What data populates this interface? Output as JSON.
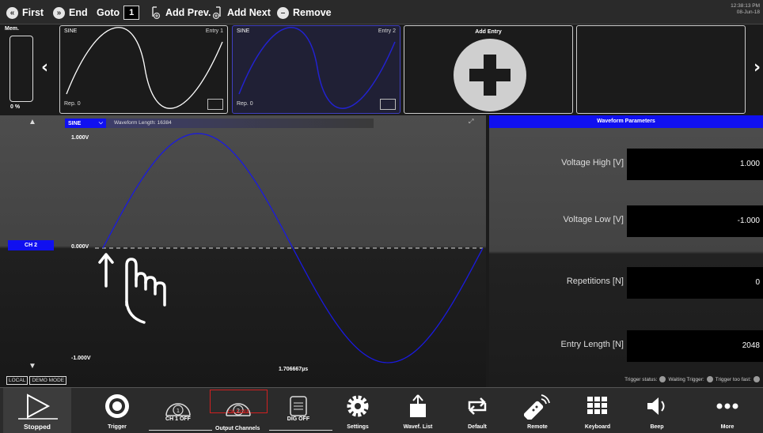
{
  "toolbar": {
    "first_label": "First",
    "end_label": "End",
    "goto_label": "Goto",
    "goto_value": "1",
    "add_prev_label": "Add Prev.",
    "add_next_label": "Add Next",
    "remove_label": "Remove",
    "time": "12:38:13 PM",
    "date": "08-Jun-18"
  },
  "sequence": {
    "mem_label": "Mem.",
    "mem_percent": "0 %",
    "entries": [
      {
        "name": "SINE",
        "entry": "Entry 1",
        "rep": "Rep. 0",
        "selected": false
      },
      {
        "name": "SINE",
        "entry": "Entry 2",
        "rep": "Rep. 0",
        "selected": true
      }
    ],
    "add_entry_label": "Add Entry"
  },
  "plot": {
    "waveform_select": "SINE",
    "waveform_length": "Waveform Length: 16384",
    "y_max": "1.000V",
    "y_mid": "0.000V",
    "y_min": "-1.000V",
    "x_label": "1.706667µs",
    "channel": "CH 2",
    "local_tag": "LOCAL",
    "demo_tag": "DEMO MODE",
    "trace_color": "#1a1ae0"
  },
  "params": {
    "header": "Waveform Parameters",
    "rows": [
      {
        "label": "Voltage High [V]",
        "value": "1.000"
      },
      {
        "label": "Voltage Low [V]",
        "value": "-1.000"
      },
      {
        "label": "Repetitions [N]",
        "value": "0"
      },
      {
        "label": "Entry Length [N]",
        "value": "2048"
      }
    ],
    "trigger_status": "Trigger status:",
    "waiting_trigger": "Waiting Trigger:",
    "trigger_too_fast": "Trigger too fast:"
  },
  "bottom": {
    "stopped": "Stopped",
    "trigger": "Trigger",
    "ch1": "CH 1 OFF",
    "ch2": "CH 2 OFF",
    "dig": "DIG OFF",
    "output_channels": "Output Channels",
    "settings": "Settings",
    "wavef_list": "Wavef. List",
    "default": "Default",
    "remote": "Remote",
    "keyboard": "Keyboard",
    "beep": "Beep",
    "more": "More"
  },
  "colors": {
    "accent_blue": "#1010f0",
    "error_red": "#d02020"
  }
}
